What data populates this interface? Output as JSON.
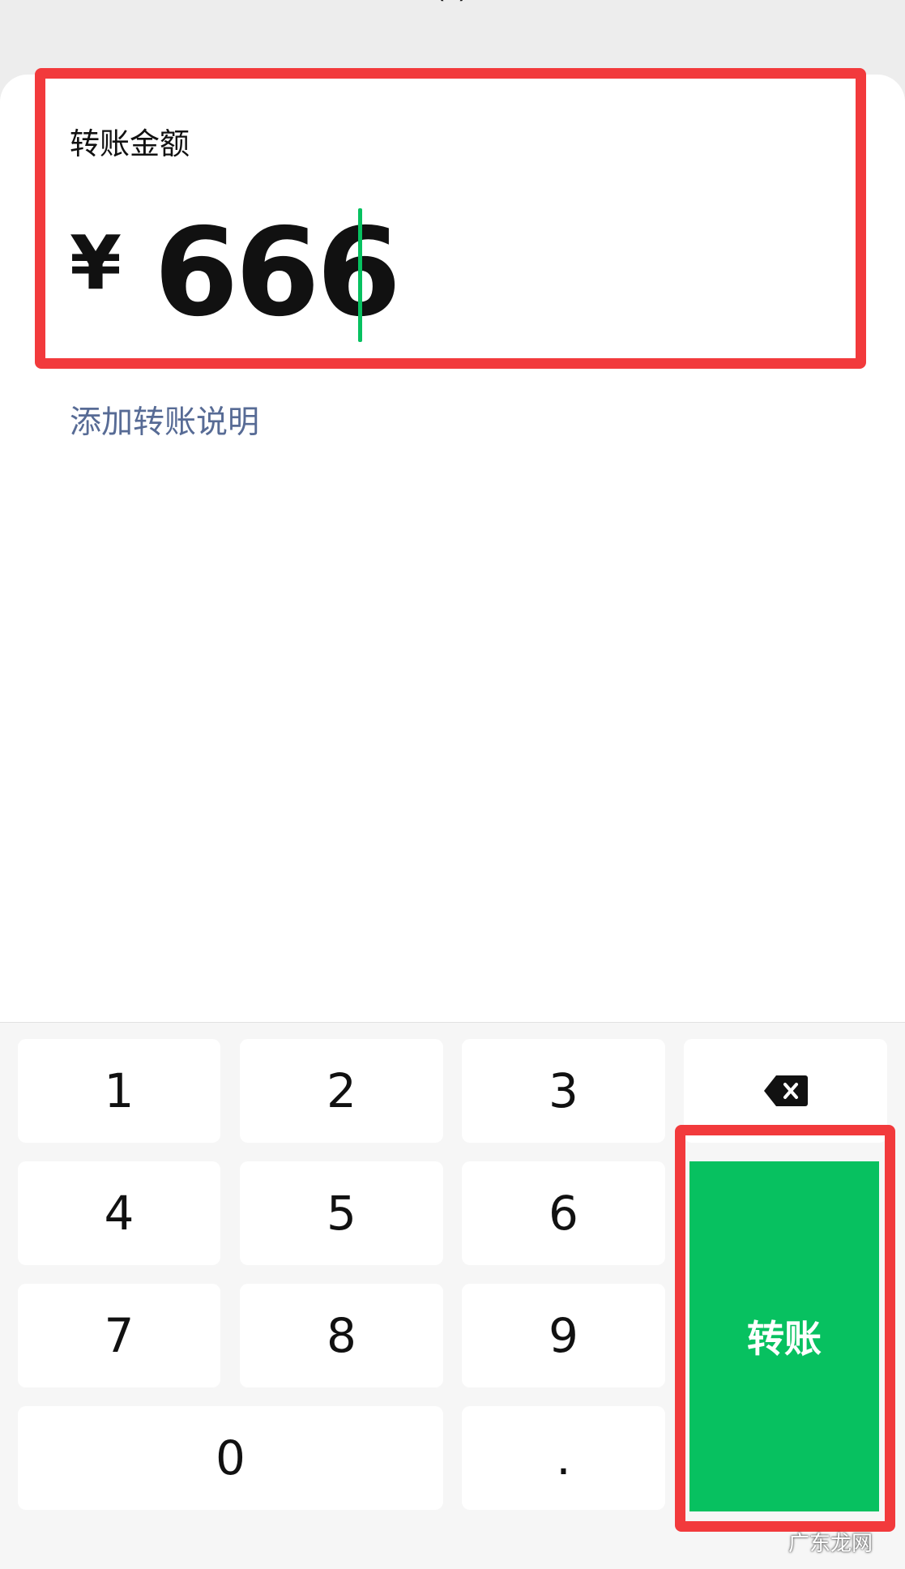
{
  "header": {
    "title_fragment": "(  )"
  },
  "amount_section": {
    "label": "转账金额",
    "currency": "¥",
    "value": "666"
  },
  "add_note_link": "添加转账说明",
  "keypad": {
    "keys": [
      "1",
      "2",
      "3",
      "4",
      "5",
      "6",
      "7",
      "8",
      "9",
      "0",
      "."
    ],
    "delete_icon": "backspace-icon",
    "confirm_label": "转账"
  },
  "watermark": "广东龙网",
  "colors": {
    "accent_green": "#07c160",
    "link_blue": "#576b95",
    "highlight_red": "#f23a3c"
  }
}
